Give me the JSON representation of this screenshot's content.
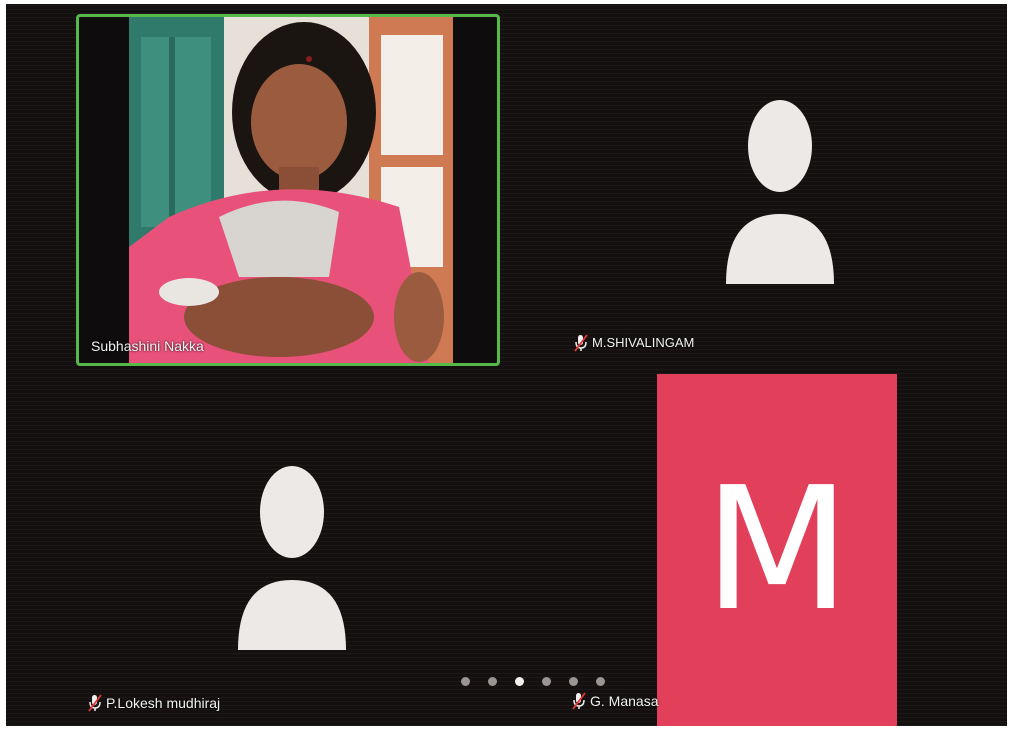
{
  "participants": [
    {
      "name": "Subhashini Nakka",
      "video_on": true,
      "muted": false,
      "active_speaker": true
    },
    {
      "name": "M.SHIVALINGAM",
      "video_on": false,
      "muted": true
    },
    {
      "name": "P.Lokesh mudhiraj",
      "video_on": false,
      "muted": true
    },
    {
      "name": "G. Manasa",
      "video_on": false,
      "muted": true,
      "avatar_letter": "M",
      "avatar_color": "#e2405a"
    }
  ],
  "pagination": {
    "pages": 6,
    "current": 3
  },
  "colors": {
    "active_speaker_border": "#57b94a",
    "background": "#141010"
  }
}
